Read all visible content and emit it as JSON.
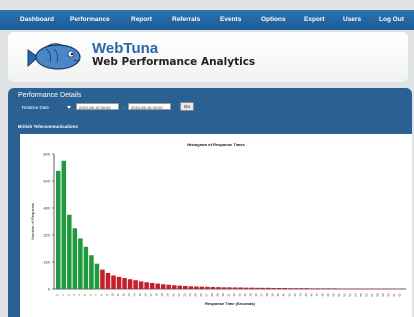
{
  "nav": {
    "items": [
      "Dashboard",
      "Performance",
      "Report",
      "Referrals",
      "Events",
      "Options",
      "Export",
      "Users",
      "Log Out"
    ]
  },
  "header": {
    "title": "WebTuna",
    "subtitle": "Web Performance Analytics",
    "logo_icon": "fish-icon"
  },
  "panel": {
    "title": "Performance Details",
    "relative_date_label": "Relative Date",
    "date_from": "2010-06-15 00:00",
    "date_separator": "-",
    "date_to": "2010-06-16 00:00",
    "go_label": "Go",
    "company": "British Telecommunications"
  },
  "colors": {
    "nav_bg": "#1e63a2",
    "panel_bg": "#2b6192",
    "fast_bar": "#1e9a3c",
    "slow_bar": "#c41f2b",
    "brand": "#2a66a8"
  },
  "chart_data": {
    "type": "bar",
    "title": "Histogram of Response Times",
    "xlabel": "Response Time (Seconds)",
    "ylabel": "Number of Requests",
    "ylim": [
      0,
      800
    ],
    "yticks": [
      0,
      160,
      320,
      480,
      640,
      800
    ],
    "categories": [
      "0",
      "1",
      "2",
      "3",
      "4",
      "5",
      "6",
      "7",
      "8",
      "9",
      "10",
      "11",
      "12",
      "13",
      "14",
      "15",
      "16",
      "17",
      "18",
      "19",
      "20",
      "21",
      "22",
      "23",
      "24",
      "25",
      "26",
      "27",
      "28",
      "29",
      "30",
      "31",
      "32",
      "33",
      "34",
      "35",
      "36",
      "37",
      "38",
      "39",
      "40",
      "41",
      "42",
      "43",
      "44",
      "45",
      "46",
      "47",
      "48",
      "49",
      "50",
      "51",
      "52",
      "53",
      "54",
      "55",
      "56",
      "57",
      "58",
      "59",
      "60",
      "61",
      "62"
    ],
    "values": [
      700,
      760,
      440,
      360,
      300,
      250,
      200,
      150,
      115,
      95,
      80,
      72,
      65,
      58,
      52,
      45,
      40,
      36,
      32,
      28,
      25,
      22,
      20,
      18,
      16,
      15,
      14,
      13,
      12,
      11,
      10,
      10,
      9,
      9,
      8,
      8,
      7,
      7,
      7,
      6,
      6,
      6,
      5,
      5,
      5,
      5,
      4,
      4,
      4,
      4,
      4,
      3,
      3,
      3,
      3,
      3,
      3,
      2,
      2,
      2,
      2,
      2,
      2
    ],
    "fast_threshold_index": 8,
    "grid": false,
    "legend": "none"
  }
}
